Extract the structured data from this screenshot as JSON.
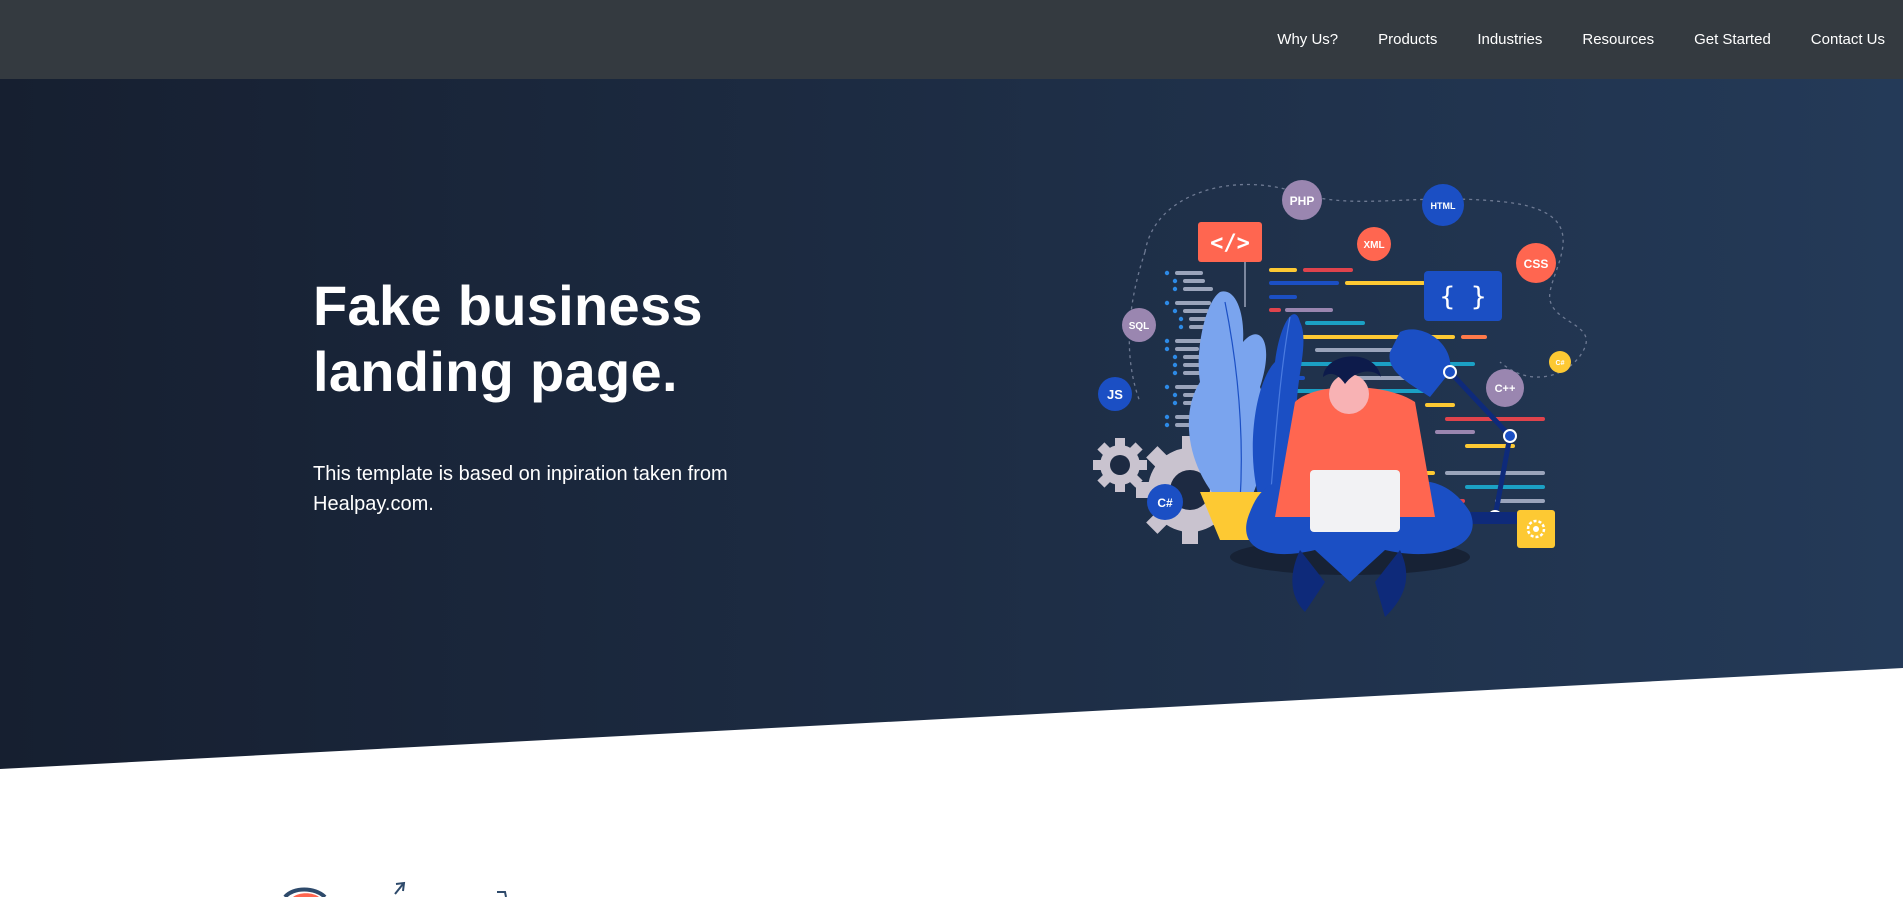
{
  "nav": {
    "items": [
      {
        "label": "Why Us?"
      },
      {
        "label": "Products"
      },
      {
        "label": "Industries"
      },
      {
        "label": "Resources"
      },
      {
        "label": "Get Started"
      },
      {
        "label": "Contact Us"
      }
    ]
  },
  "hero": {
    "title": "Fake business landing page.",
    "subtitle": "This template is based on inpiration taken from Healpay.com."
  },
  "illustration": {
    "badges": {
      "php": "PHP",
      "html": "HTML",
      "css": "CSS",
      "xml": "XML",
      "sql": "SQL",
      "js": "JS",
      "cpp": "C++",
      "csharp": "C#",
      "csharp_small": "C#",
      "code_tag": "</>",
      "braces": "{ }"
    }
  },
  "colors": {
    "navbar": "#343a40",
    "hero_dark": "#161f30",
    "hero_light": "#243a58",
    "accent_coral": "#ff6650",
    "accent_blue": "#1b4fc4",
    "accent_yellow": "#fdc933",
    "accent_purple": "#9a86b0"
  }
}
